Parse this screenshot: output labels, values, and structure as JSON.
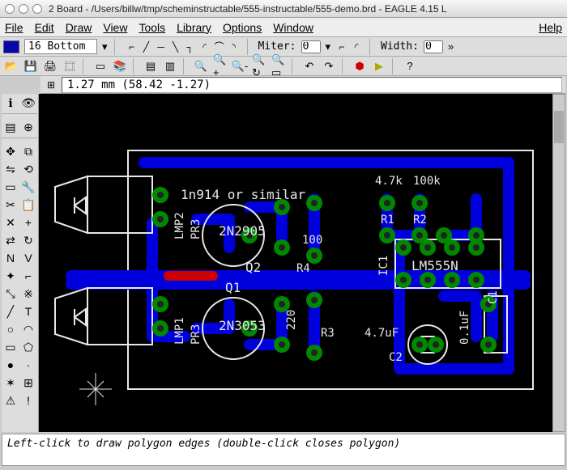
{
  "window": {
    "title": "2 Board - /Users/billw/tmp/scheminstructable/555-instructable/555-demo.brd - EAGLE 4.15 L"
  },
  "menu": {
    "file": "File",
    "edit": "Edit",
    "draw": "Draw",
    "view": "View",
    "tools": "Tools",
    "library": "Library",
    "options": "Options",
    "window": "Window",
    "help": "Help"
  },
  "params": {
    "layer_name": "16 Bottom",
    "miter_label": "Miter:",
    "miter_value": "0",
    "width_label": "Width:",
    "width_value": "0"
  },
  "coord": {
    "text": "1.27 mm (58.42 -1.27)"
  },
  "status": {
    "text": "Left-click to draw polygon edges (double-click closes polygon)"
  },
  "tool_icons": {
    "open": "📂",
    "save": "💾",
    "print": "🖨",
    "cam": "⿴",
    "board": "▭",
    "sheet": "▦",
    "lib": "📚",
    "zfit": "🔍",
    "zin": "🔍+",
    "zout": "🔍-",
    "zredraw": "🔍↻",
    "zsel": "🔍▭",
    "undo": "↶",
    "redo": "↷",
    "stop": "⬢",
    "go": "▶",
    "help": "?"
  },
  "palette": [
    {
      "n": "info-tool",
      "g": "ℹ"
    },
    {
      "n": "eye-tool",
      "g": "👁"
    },
    {
      "n": "layer-tool",
      "g": "▤"
    },
    {
      "n": "mark-tool",
      "g": "⊕"
    },
    {
      "n": "move-tool",
      "g": "✥"
    },
    {
      "n": "copy-tool",
      "g": "⧉"
    },
    {
      "n": "mirror-tool",
      "g": "⇋"
    },
    {
      "n": "rotate-tool",
      "g": "⟲"
    },
    {
      "n": "group-tool",
      "g": "▭"
    },
    {
      "n": "change-tool",
      "g": "🔧"
    },
    {
      "n": "cut-tool",
      "g": "✂"
    },
    {
      "n": "paste-tool",
      "g": "📋"
    },
    {
      "n": "delete-tool",
      "g": "✕"
    },
    {
      "n": "add-tool",
      "g": "+"
    },
    {
      "n": "pinswap-tool",
      "g": "⇄"
    },
    {
      "n": "replace-tool",
      "g": "↻"
    },
    {
      "n": "name-tool",
      "g": "N"
    },
    {
      "n": "value-tool",
      "g": "V"
    },
    {
      "n": "smash-tool",
      "g": "✦"
    },
    {
      "n": "miter-tool",
      "g": "⌐"
    },
    {
      "n": "split-tool",
      "g": "⤡"
    },
    {
      "n": "optimize-tool",
      "g": "※"
    },
    {
      "n": "route-tool",
      "g": "╱"
    },
    {
      "n": "text-tool",
      "g": "T"
    },
    {
      "n": "circle-tool",
      "g": "○"
    },
    {
      "n": "arc-tool",
      "g": "◠"
    },
    {
      "n": "rect-tool",
      "g": "▭"
    },
    {
      "n": "poly-tool",
      "g": "⬠"
    },
    {
      "n": "via-tool",
      "g": "●"
    },
    {
      "n": "signal-tool",
      "g": "·"
    },
    {
      "n": "ratsnest-tool",
      "g": "✶"
    },
    {
      "n": "auto-tool",
      "g": "⊞"
    },
    {
      "n": "erc-tool",
      "g": "⚠"
    },
    {
      "n": "errors-tool",
      "g": "!"
    }
  ],
  "pcb": {
    "labels": {
      "d1": "1n914 or similar",
      "q1": "Q1",
      "q1v": "2N3053",
      "q2": "Q2",
      "q2v": "2N2905",
      "r1": "R1",
      "r1v": "4.7k",
      "r2": "R2",
      "r2v": "100k",
      "r3": "R3",
      "r3v": "220",
      "r4": "R4",
      "r4v": "100",
      "c1": "C1",
      "c1v": "0.1uF",
      "c2": "C2",
      "c2v": "4.7uF",
      "ic1": "IC1",
      "ic1v": "LM555N",
      "lmp1": "LMP1",
      "lmp2": "LMP2",
      "pr3a": "PR3",
      "pr3b": "PR3"
    }
  },
  "chart_data": null
}
